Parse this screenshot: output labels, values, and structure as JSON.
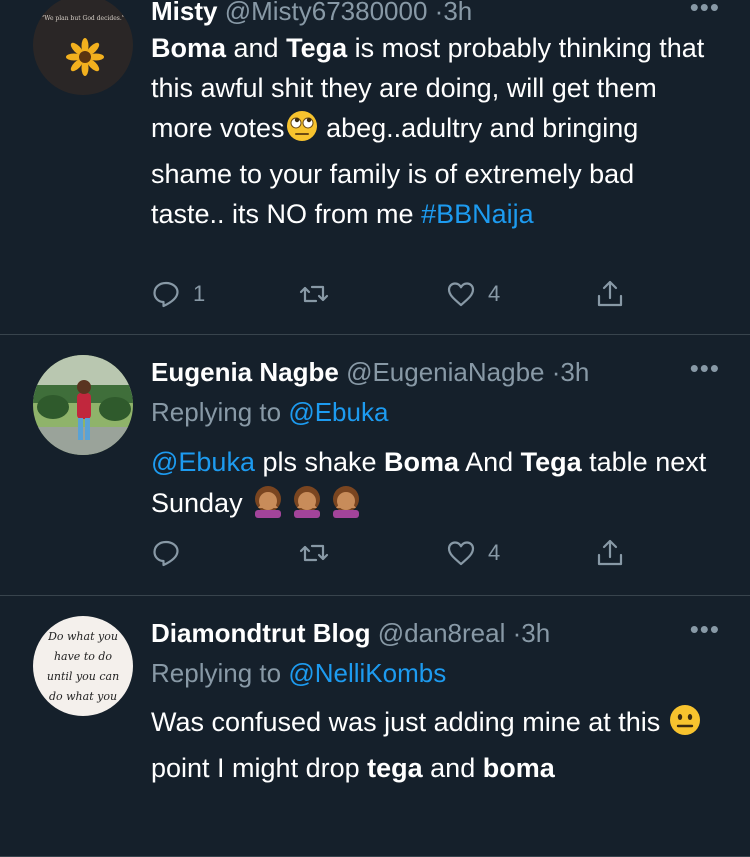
{
  "tweets": [
    {
      "name": "Misty",
      "handle": "@Misty67380000",
      "time": "3h",
      "body": {
        "b1": "Boma",
        "t1": " and ",
        "b2": "Tega",
        "t2": " is most probably thinking that this awful shit they are doing, will get them more votes",
        "t3": " abeg..adultry and bringing shame to your family is of extremely bad taste.. its NO from me ",
        "hashtag": "#BBNaija"
      },
      "avatar_text": "\"We plan but God decides.\"",
      "replies": "1",
      "retweets": "",
      "likes": "4"
    },
    {
      "name": "Eugenia  Nagbe",
      "handle": "@EugeniaNagbe",
      "time": "3h",
      "replying_label": "Replying to ",
      "replying_to": "@Ebuka",
      "body": {
        "mention": "@Ebuka",
        "t1": "  pls shake ",
        "b1": "Boma",
        "t2": " And ",
        "b2": "Tega",
        "t3": " table next Sunday "
      },
      "replies": "",
      "retweets": "",
      "likes": "4"
    },
    {
      "name": "Diamondtrut  Blog",
      "handle": "@dan8real",
      "time": "3h",
      "replying_label": "Replying to ",
      "replying_to": "@NelliKombs",
      "body": {
        "t1": "Was confused was just adding mine at this ",
        "t2": " point I might drop ",
        "b1": "tega",
        "t3": " and ",
        "b2": "boma"
      },
      "avatar_text": [
        "Do what you",
        "have to do",
        "until you can",
        "do what you"
      ]
    }
  ],
  "icons": {
    "reply": "reply-icon",
    "retweet": "retweet-icon",
    "like": "heart-icon",
    "share": "share-icon",
    "more": "more-icon"
  },
  "colors": {
    "background": "#15202b",
    "secondary": "#8899a6",
    "link": "#1d9bf0",
    "divider": "#38444d"
  }
}
